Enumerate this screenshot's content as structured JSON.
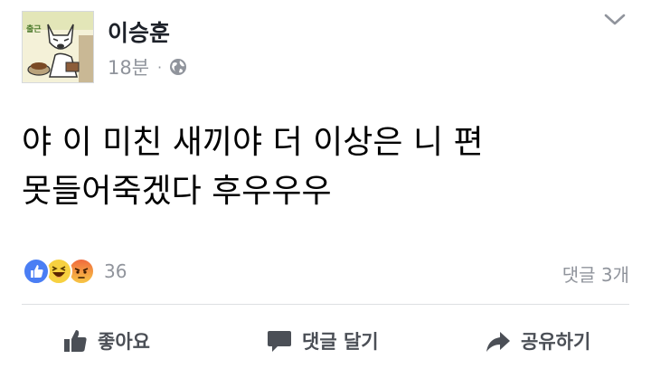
{
  "post": {
    "author": "이승훈",
    "time": "18분",
    "separator": "·",
    "privacy_icon": "globe-icon",
    "menu_icon": "chevron-down-icon",
    "avatar_sign": "출근",
    "text": "야 이 미친 새끼야 더 이상은 니 편\n못들어죽겠다 후우우우"
  },
  "reactions": {
    "icons": [
      "like-reaction-icon",
      "haha-reaction-icon",
      "angry-reaction-icon"
    ],
    "count": "36",
    "comments": "댓글 3개"
  },
  "actions": {
    "like": "좋아요",
    "comment": "댓글 달기",
    "share": "공유하기"
  },
  "colors": {
    "like_blue": "#4a7ef4",
    "text_gray": "#90949c",
    "action_gray": "#4b4f56"
  }
}
